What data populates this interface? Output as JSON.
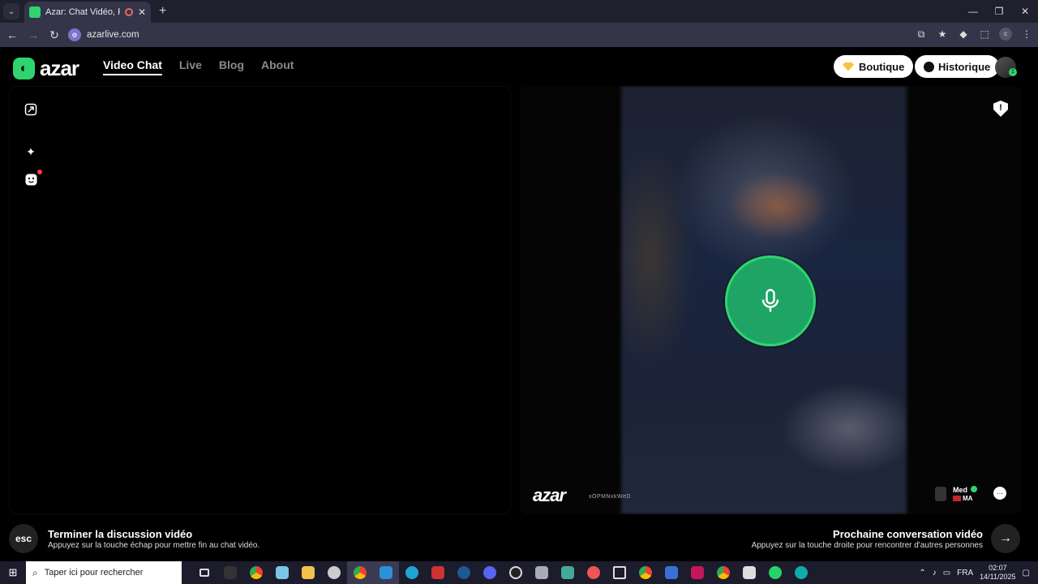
{
  "browser": {
    "tab_title": "Azar: Chat Vidéo, Rencontr",
    "new_tab": "+",
    "url": "azarlive.com",
    "window_controls": [
      "—",
      "❐",
      "✕"
    ]
  },
  "site": {
    "logo_text": "azar",
    "nav": [
      {
        "label": "Video Chat",
        "active": true
      },
      {
        "label": "Live"
      },
      {
        "label": "Blog"
      },
      {
        "label": "About"
      }
    ],
    "boutique_label": "Boutique",
    "historique_label": "Historique",
    "user_badge": "1"
  },
  "remote": {
    "watermark": "azar",
    "watermark_id": "xOPMNxkWeD",
    "peer_name": "Med",
    "peer_country": "MA"
  },
  "footer": {
    "esc_label": "esc",
    "end_title": "Terminer la discussion vidéo",
    "end_sub": "Appuyez sur la touche échap pour mettre fin au chat vidéo.",
    "next_title": "Prochaine conversation vidéo",
    "next_sub": "Appuyez sur la touche droite pour rencontrer d'autres personnes",
    "next_icon": "→"
  },
  "taskbar": {
    "search_placeholder": "Taper ici pour rechercher",
    "lang": "FRA",
    "time": "02:07",
    "date": "14/11/2025",
    "notif_count": "18"
  },
  "colors": {
    "brand_green": "#2fd46f",
    "mic_green": "#1ea565",
    "alert_red": "#ff3a5c"
  },
  "icons": [
    "expand-icon",
    "sparkle-icon",
    "face-filter-icon",
    "microphone-icon",
    "report-shield-icon",
    "chat-bubble-icon",
    "arrow-right-icon",
    "diamond-icon",
    "clock-icon"
  ]
}
